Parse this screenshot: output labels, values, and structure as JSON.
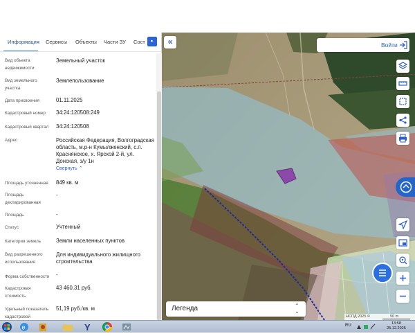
{
  "tabs": [
    {
      "label": "Информация",
      "active": true
    },
    {
      "label": "Сервисы"
    },
    {
      "label": "Объекты"
    },
    {
      "label": "Части ЗУ"
    },
    {
      "label": "Сост"
    }
  ],
  "info_rows": [
    {
      "label": "Вид объекта недвижимости",
      "value": "Земельный участок"
    },
    {
      "label": "Вид земельного участка",
      "value": "Землепользование"
    },
    {
      "label": "Дата присвоения",
      "value": "01.11.2025"
    },
    {
      "label": "Кадастровый номер",
      "value": "34:24:120508:249"
    },
    {
      "label": "Кадастровый квартал",
      "value": "34:24:120508"
    },
    {
      "label": "Адрес",
      "value": "Российская Федерация, Волгоградская область, м.р-н Кумылженский, с.п. Краснянское, х. Ярской 2-й, ул. Донская, з/у 1н",
      "link": "Свернуть"
    },
    {
      "label": "Площадь уточненная",
      "value": "849 кв. м"
    },
    {
      "label": "Площадь декларированная",
      "value": "-"
    },
    {
      "label": "Площадь",
      "value": "-"
    },
    {
      "label": "Статус",
      "value": "Учтенный"
    },
    {
      "label": "Категория земель",
      "value": "Земли населенных пунктов"
    },
    {
      "label": "Вид разрешенного использования",
      "value": "Для индивидуального жилищного строительства"
    },
    {
      "label": "Форма собственности",
      "value": "-"
    },
    {
      "label": "Кадастровая стоимость",
      "value": "43 460,31 руб."
    },
    {
      "label": "Удельный показатель кадастровой",
      "value": "51,19 руб./кв. м"
    }
  ],
  "map": {
    "login_label": "Войти",
    "legend_label": "Легенда",
    "attribution": "НСПД 2025 ©",
    "scale_label": "50 m"
  },
  "icons": {
    "collapse": "double-chevron-left-icon",
    "login": "login-arrow-icon",
    "tools": [
      "layers-icon",
      "ruler-icon",
      "select-area-icon",
      "share-icon",
      "print-icon",
      "locate-icon",
      "basemap-icon",
      "search-location-icon",
      "zoom-in-icon",
      "zoom-out-icon"
    ],
    "legend_arrow": "expand-collapse-icon",
    "tab_next": "chevron-right-icon"
  },
  "taskbar": {
    "lang": "RU",
    "time": "13:58",
    "date": "25.12.2025"
  },
  "colors": {
    "accent": "#2b63d9",
    "plot_highlight": "#8a3fa8"
  }
}
